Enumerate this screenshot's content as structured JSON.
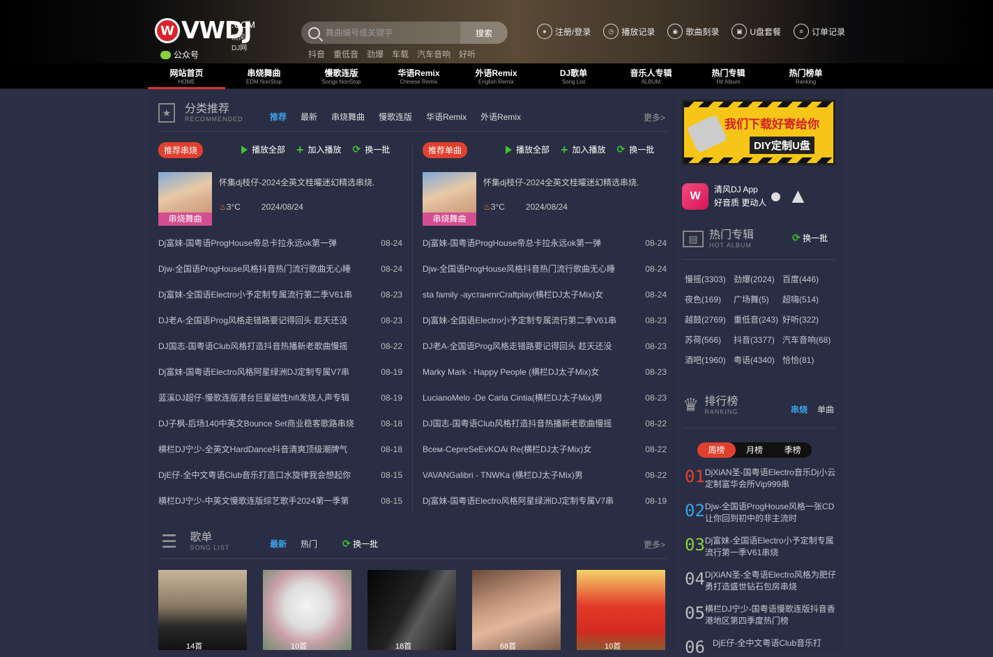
{
  "header": {
    "logo_text": "VWDJ",
    "logo_com": ".COM",
    "logo_cn": "清风DJ网",
    "wechat_label": "公众号",
    "search_placeholder": "舞曲编号或关键字",
    "search_button": "搜索",
    "hot_keywords": [
      "抖音",
      "重低音",
      "劲爆",
      "车载",
      "汽车音响",
      "好听"
    ],
    "links": [
      {
        "icon": "user-icon",
        "label": "注册/登录"
      },
      {
        "icon": "clock-icon",
        "label": "播放记录"
      },
      {
        "icon": "disc-icon",
        "label": "歌曲刻录"
      },
      {
        "icon": "usb-icon",
        "label": "U盘套餐"
      },
      {
        "icon": "order-icon",
        "label": "订单记录"
      }
    ]
  },
  "nav": [
    {
      "cn": "网站首页",
      "en": "HOME",
      "active": true
    },
    {
      "cn": "串烧舞曲",
      "en": "EDM NonStop"
    },
    {
      "cn": "慢歌连版",
      "en": "Songs NonStop"
    },
    {
      "cn": "华语Remix",
      "en": "Chinese Remix"
    },
    {
      "cn": "外语Remix",
      "en": "English Remix"
    },
    {
      "cn": "DJ歌单",
      "en": "Song List"
    },
    {
      "cn": "音乐人专辑",
      "en": "ALBUM"
    },
    {
      "cn": "热门专辑",
      "en": "Hit Album"
    },
    {
      "cn": "热门榜单",
      "en": "Ranking"
    }
  ],
  "recommend": {
    "title": "分类推荐",
    "subtitle": "RECOMMENDED",
    "tabs": [
      "推荐",
      "最新",
      "串烧舞曲",
      "慢歌连版",
      "华语Remix",
      "外语Remix"
    ],
    "more": "更多>",
    "play_all": "播放全部",
    "add_play": "加入播放",
    "refresh": "换一批",
    "left": {
      "badge": "推荐串烧",
      "feature": {
        "title": "怀集dj枝仔-2024全英文桂曤迷幻精选串烧.",
        "temp": "3°C",
        "date": "2024/08/24",
        "tag": "串烧舞曲"
      },
      "rows": [
        {
          "t": "Dj富妹-国粤语ProgHouse帝总卡拉永远ok第一弹",
          "d": "08-24"
        },
        {
          "t": "Djw-全国语ProgHouse风格抖音热门流行歌曲无心睡",
          "d": "08-24"
        },
        {
          "t": "Dj富妹-全国语Electro小予定制专属流行第二季V61串",
          "d": "08-23"
        },
        {
          "t": "DJ老A-全国语Prog风格走错路要记得回头 趁天还没",
          "d": "08-23"
        },
        {
          "t": "DJ国志-国粤语Club风格打造抖音热播新老歌曲慢摇",
          "d": "08-22"
        },
        {
          "t": "Dj富妹-国粤语Electro风格阿星绿洲DJ定制专属V7串",
          "d": "08-19"
        },
        {
          "t": "蓝溪DJ超仔-慢歌连版港台巨星磁性hifi发烧人声专辑",
          "d": "08-19"
        },
        {
          "t": "DJ子枫-后场140中英文Bounce Set商业稳客歌路串烧",
          "d": "08-18"
        },
        {
          "t": "横栏DJ宁少-全英文HardDance抖音清爽顶级潮牌气",
          "d": "08-18"
        },
        {
          "t": "DjE仔-全中文粤语Club音乐打造口水旋律我会想起你",
          "d": "08-15"
        },
        {
          "t": "横栏DJ宁少-中英文慢歌连版综艺歌手2024第一季第",
          "d": "08-15"
        }
      ]
    },
    "right": {
      "badge": "推荐单曲",
      "feature": {
        "title": "怀集dj枝仔-2024全英文桂曤迷幻精选串烧.",
        "temp": "3°C",
        "date": "2024/08/24",
        "tag": "串烧舞曲"
      },
      "rows": [
        {
          "t": "Dj富妹-国粤语ProgHouse帝总卡拉永远ok第一弹",
          "d": "08-24"
        },
        {
          "t": "Djw-全国语ProgHouse风格抖音热门流行歌曲无心睡",
          "d": "08-24"
        },
        {
          "t": "sta family -аустанrnrCraftplay(横栏DJ太子Mix)女",
          "d": "08-24"
        },
        {
          "t": "Dj富妹-全国语Electro小予定制专属流行第二季V61串",
          "d": "08-23"
        },
        {
          "t": "DJ老A-全国语Prog风格走错路要记得回头 趁天还没",
          "d": "08-23"
        },
        {
          "t": "Marky Mark - Happy People (横栏DJ太子Mix)女",
          "d": "08-23"
        },
        {
          "t": "LucianoMelo -De Carla Cintia(横栏DJ太子Mix)男",
          "d": "08-23"
        },
        {
          "t": "DJ国志-国粤语Club风格打造抖音热播新老歌曲慢摇",
          "d": "08-22"
        },
        {
          "t": "Всем-CepreSeEvKOAi Re(横栏DJ太子Mix)女",
          "d": "08-22"
        },
        {
          "t": "VAVANGalibri - TNWKa (横栏DJ太子Mix)男",
          "d": "08-22"
        },
        {
          "t": "Dj富妹-国粤语Electro风格阿星绿洲DJ定制专属V7串",
          "d": "08-19"
        }
      ]
    }
  },
  "songlist": {
    "title": "歌单",
    "subtitle": "SONG LIST",
    "tabs": [
      "最新",
      "热门"
    ],
    "refresh": "换一批",
    "more": "更多>",
    "items": [
      {
        "count": "14首"
      },
      {
        "count": "10首"
      },
      {
        "count": "18首"
      },
      {
        "count": "68首"
      },
      {
        "count": "10首"
      }
    ]
  },
  "side": {
    "banner_line1": "我们下载好寄给你",
    "banner_line2": "DIY定制U盘",
    "app_line1": "清风DJ App",
    "app_line2": "好音质  更动人",
    "hot_album_title": "热门专辑",
    "hot_album_sub": "HOT ALBUM",
    "hot_album_refresh": "换一批",
    "tags": [
      "慢摇(3303)",
      "劲爆(2024)",
      "百度(446)",
      "夜色(169)",
      "广场舞(5)",
      "超嗨(514)",
      "越鼓(2769)",
      "重低音(243)",
      "好听(322)",
      "苏荷(566)",
      "抖音(3377)",
      "汽车音响(68)",
      "酒吧(1960)",
      "粤语(4340)",
      "恰恰(81)"
    ],
    "rank_title": "排行榜",
    "rank_sub": "RANKING",
    "rank_tabs": [
      "串烧",
      "单曲"
    ],
    "rank_periods": [
      "周榜",
      "月榜",
      "季榜"
    ],
    "ranks": [
      {
        "n": "01",
        "color": "#e0412e",
        "t": "DjXiAN圣-国粤语Electro音乐Dj小云定制富华会所Vip999串"
      },
      {
        "n": "02",
        "color": "#3aa3e8",
        "t": "Djw-全国语ProgHouse风格一张CD让你回到初中的非主流时"
      },
      {
        "n": "03",
        "color": "#8bd13b",
        "t": "Dj富妹-全国语Electro小予定制专属流行第一季V61串烧"
      },
      {
        "n": "04",
        "color": "#bbbbbb",
        "t": "DjXiAN圣-全粤语Electro风格为肥仔勇打造盛世钻石包房串烧"
      },
      {
        "n": "05",
        "color": "#bbbbbb",
        "t": "横栏DJ宁少-国粤语慢歌连版抖音香港地区第四季度热门榜"
      },
      {
        "n": "06",
        "color": "#bbbbbb",
        "t": "DjE仔-全中文粤语Club音乐打"
      }
    ]
  }
}
